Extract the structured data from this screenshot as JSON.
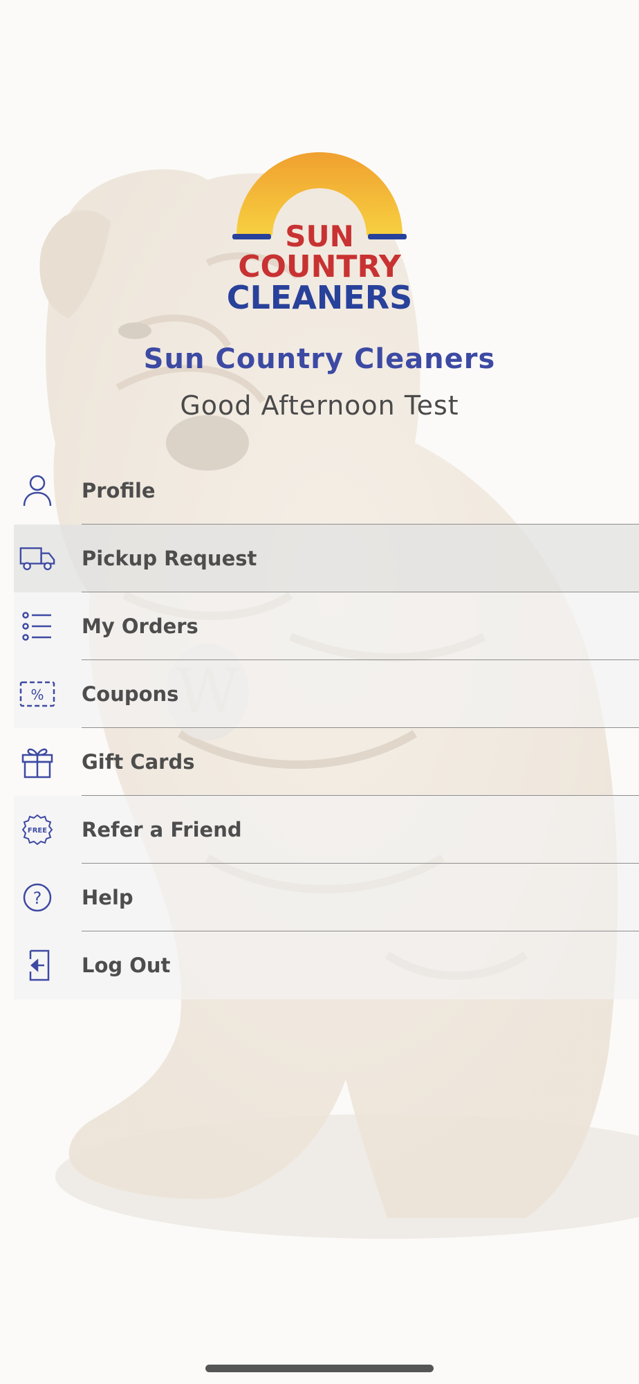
{
  "logo": {
    "line1": "SUN",
    "line2": "COUNTRY",
    "line3": "CLEANERS",
    "colors": {
      "sun_top": "#f0a030",
      "sun_bottom": "#f7d040",
      "red": "#c83232",
      "blue": "#28419a"
    }
  },
  "business_name": "Sun Country Cleaners",
  "greeting": "Good Afternoon Test",
  "menu": {
    "items": [
      {
        "label": "Profile",
        "icon": "person-icon"
      },
      {
        "label": "Pickup Request",
        "icon": "delivery-truck-icon"
      },
      {
        "label": "My Orders",
        "icon": "list-icon"
      },
      {
        "label": "Coupons",
        "icon": "coupon-percent-icon"
      },
      {
        "label": "Gift Cards",
        "icon": "gift-icon"
      },
      {
        "label": "Refer a Friend",
        "icon": "free-badge-icon",
        "icon_text": "FREE"
      },
      {
        "label": "Help",
        "icon": "help-circle-icon",
        "icon_text": "?"
      },
      {
        "label": "Log Out",
        "icon": "logout-icon"
      }
    ]
  },
  "colors": {
    "accent": "#3d4aa3",
    "text": "#4d4d4d",
    "divider": "#8d8d8d"
  }
}
